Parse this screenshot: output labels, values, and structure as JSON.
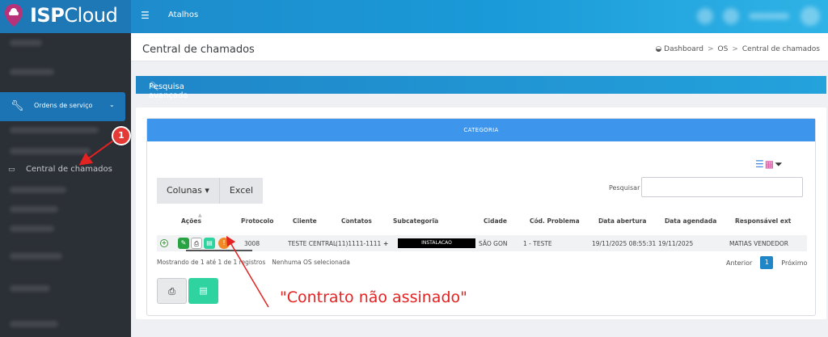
{
  "topbar": {
    "logo_bold": "ISP",
    "logo_thin": "Cloud",
    "menu_icon": "hamburger-icon",
    "atalhos": "Atalhos"
  },
  "sidebar": {
    "active": {
      "label": "Ordens de serviço",
      "icon": "wrench-icon"
    },
    "central": {
      "label": "Central de chamados",
      "icon": "laptop-icon"
    },
    "marker": "1"
  },
  "header": {
    "title": "Central de chamados",
    "breadcrumb": [
      "Dashboard",
      "OS",
      "Central de chamados"
    ]
  },
  "search_bar": {
    "label": "Pesquisa avançada",
    "icon": "search-icon"
  },
  "card": {
    "heading": "CATEGORIA",
    "buttons": {
      "columns": "Colunas",
      "excel": "Excel"
    },
    "search_label": "Pesquisar",
    "table": {
      "columns": [
        "Ações",
        "Protocolo",
        "Cliente",
        "Contatos",
        "Subcategoria",
        "Cidade",
        "Cód. Problema",
        "Data abertura",
        "Data agendada",
        "Responsável ext"
      ],
      "rows": [
        {
          "protocolo": "3008",
          "cliente": "TESTE CENTRAL",
          "contatos": "(11)1111-1111",
          "extra": "+",
          "subcategoria": "INSTALACAO",
          "cidade": "SÃO GON",
          "problema": "1 - TESTE",
          "abertura": "19/11/2025 08:55:31",
          "agendada": "19/11/2025",
          "responsavel": "MATIAS VENDEDOR"
        }
      ]
    },
    "info": "Mostrando de 1 até 1 de 1 registros",
    "selected": "Nenhuma OS selecionada",
    "pagination": {
      "prev": "Anterior",
      "page": "1",
      "next": "Próximo"
    }
  },
  "annotation": "\"Contrato não assinado\"",
  "colors": {
    "brand_blue": "#1f86c8",
    "card_head": "#3d96ec",
    "annotation_red": "#e32222",
    "sidebar": "#2b2f36"
  }
}
